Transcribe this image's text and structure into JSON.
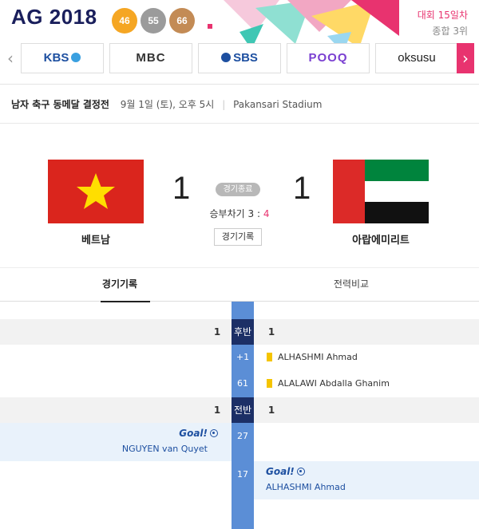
{
  "banner": {
    "logo_prefix": "AG",
    "logo_year": "2018",
    "medals": {
      "gold": "46",
      "silver": "55",
      "bronze": "66"
    },
    "rank_day": "대회 15일차",
    "rank_overall": "종합 3위",
    "accent_color": "#e8336f"
  },
  "broadcasters": {
    "left_arrow_icon": "chevron-left-icon",
    "right_arrow_icon": "chevron-right-icon",
    "channels": [
      "KBS",
      "MBC",
      "SBS",
      "POOQ",
      "oksusu"
    ]
  },
  "match": {
    "title": "남자 축구 동메달 결정전",
    "datetime": "9월 1일 (토), 오후 5시",
    "venue": "Pakansari Stadium"
  },
  "scoreboard": {
    "home_team": "베트남",
    "away_team": "아랍에미리트",
    "home_score": "1",
    "away_score": "1",
    "status": "경기종료",
    "penalty_label": "승부차기",
    "penalty_home": "3",
    "penalty_sep": ":",
    "penalty_away": "4",
    "record_button": "경기기록"
  },
  "tabs": {
    "record": "경기기록",
    "compare": "전력비교"
  },
  "timeline": {
    "second_half": {
      "label": "후반",
      "home": "1",
      "away": "1"
    },
    "events_second": [
      {
        "minute": "+1",
        "card": "yellow",
        "player": "ALHASHMI Ahmad"
      },
      {
        "minute": "61",
        "card": "yellow",
        "player": "ALALAWI Abdalla Ghanim"
      }
    ],
    "first_half": {
      "label": "전반",
      "home": "1",
      "away": "1"
    },
    "goals": [
      {
        "minute": "27",
        "side": "home",
        "label": "Goal!",
        "player": "NGUYEN van Quyet"
      },
      {
        "minute": "17",
        "side": "away",
        "label": "Goal!",
        "player": "ALHASHMI Ahmad"
      }
    ]
  }
}
